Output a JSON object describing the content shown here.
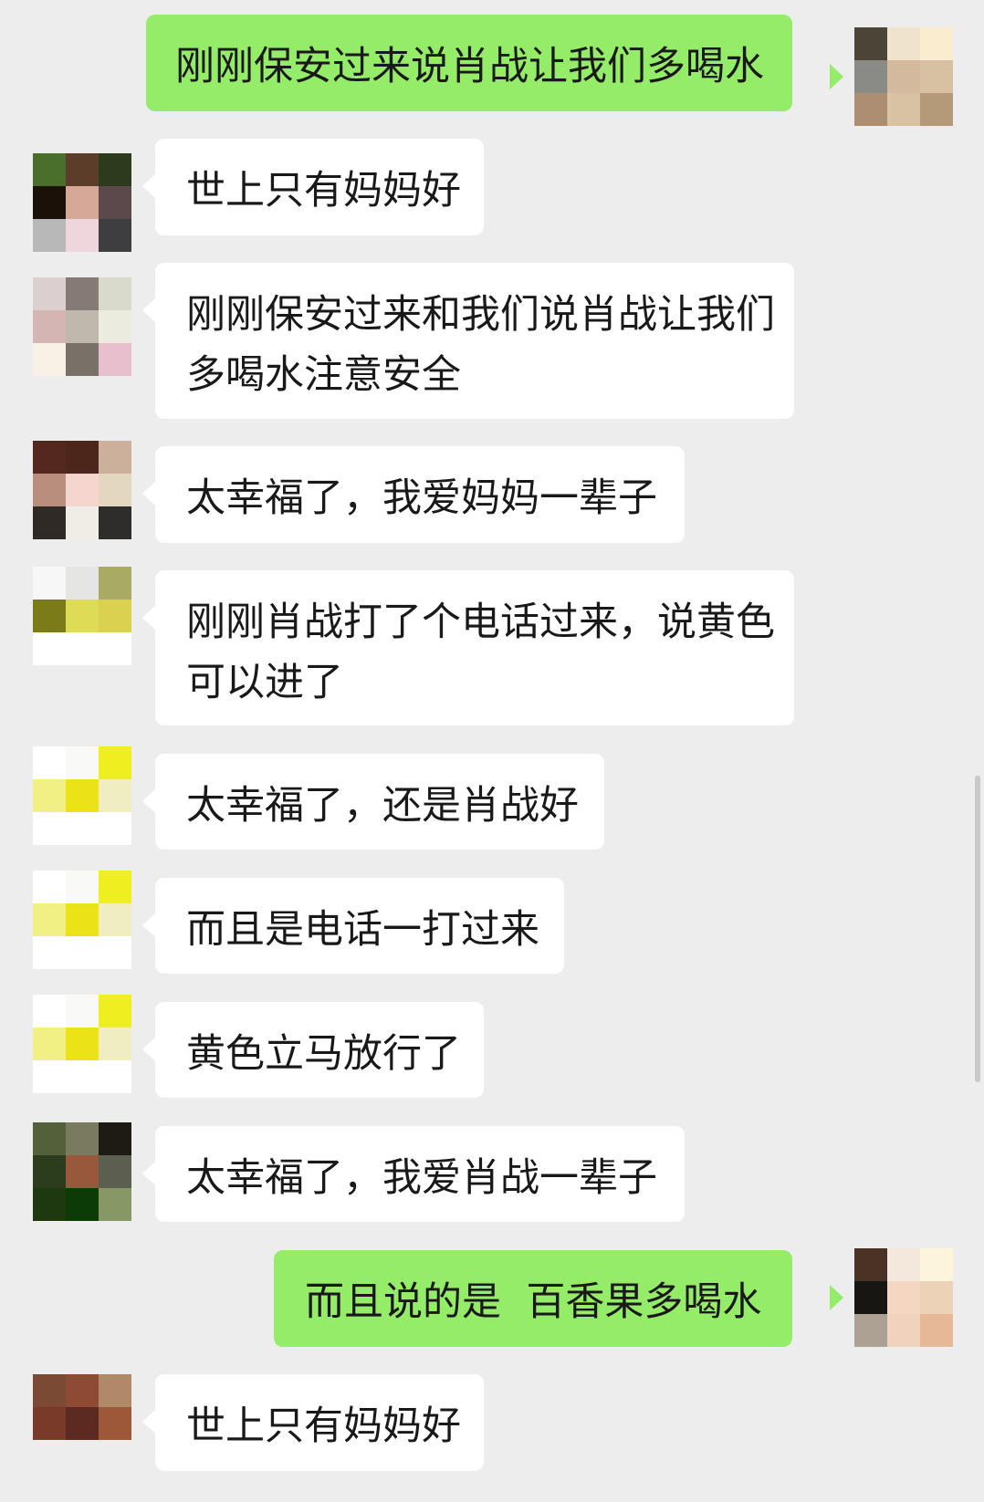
{
  "chat": {
    "messages": [
      {
        "side": "right",
        "text": "刚刚保安过来说肖战让我们多喝水",
        "avatar": [
          "#4b4538",
          "#f0e3cd",
          "#faeccf",
          "#8a8a86",
          "#d3b99e",
          "#d8c1a2",
          "#ad8e73",
          "#d9c2a4",
          "#b49a78"
        ]
      },
      {
        "side": "left",
        "text": "世上只有妈妈好",
        "avatar": [
          "#4a6f2d",
          "#5b3d2a",
          "#2c3a1e",
          "#1c1109",
          "#d6a898",
          "#5c494b",
          "#b8b8b8",
          "#efd5dc",
          "#3e3e40"
        ]
      },
      {
        "side": "left",
        "text": "刚刚保安过来和我们说肖战让我们\n多喝水注意安全",
        "avatar": [
          "#dccfcf",
          "#857a74",
          "#d9d9cc",
          "#d5b5b3",
          "#bfb8ac",
          "#ecebdf",
          "#f9f0e6",
          "#787168",
          "#e8bfcd"
        ]
      },
      {
        "side": "left",
        "text": "太幸福了，我爱妈妈一辈子",
        "avatar": [
          "#52281f",
          "#4c261b",
          "#cdb09b",
          "#b88e7d",
          "#f4d6ce",
          "#e3d7c1",
          "#2f2a26",
          "#f0ece6",
          "#2f2d2c"
        ]
      },
      {
        "side": "left",
        "text": "刚刚肖战打了个电话过来，说黄色\n可以进了",
        "avatar": [
          "#f7f7f7",
          "#e5e5e3",
          "#a9aa63",
          "#7b7b19",
          "#dedb57",
          "#d9d14f",
          "#ffffff",
          "#ffffff",
          "#ffffff"
        ]
      },
      {
        "side": "left",
        "text": "太幸福了，还是肖战好",
        "avatar": [
          "#ffffff",
          "#f9f9f7",
          "#efef20",
          "#f1f084",
          "#ece316",
          "#f0edc0",
          "#ffffff",
          "#ffffff",
          "#ffffff"
        ]
      },
      {
        "side": "left",
        "text": "而且是电话一打过来",
        "avatar": [
          "#ffffff",
          "#f9f9f7",
          "#efef20",
          "#f1f084",
          "#ece316",
          "#f0edc0",
          "#ffffff",
          "#ffffff",
          "#ffffff"
        ]
      },
      {
        "side": "left",
        "text": "黄色立马放行了",
        "avatar": [
          "#ffffff",
          "#f9f9f7",
          "#efef20",
          "#f1f084",
          "#ece316",
          "#f0edc0",
          "#ffffff",
          "#ffffff",
          "#ffffff"
        ]
      },
      {
        "side": "left",
        "text": "太幸福了，我爱肖战一辈子",
        "avatar": [
          "#546039",
          "#7a7a60",
          "#1d1b12",
          "#2c3d1e",
          "#98583b",
          "#5c5f50",
          "#1e3810",
          "#0c3b08",
          "#879866"
        ]
      },
      {
        "side": "right",
        "text": "而且说的是  百香果多喝水",
        "avatar": [
          "#4a3325",
          "#f4e8dc",
          "#fdf4dc",
          "#181612",
          "#f3d7c0",
          "#ecd3b8",
          "#aca192",
          "#efd3bd",
          "#e6b898"
        ]
      },
      {
        "side": "left",
        "text": "世上只有妈妈好",
        "avatar": [
          "#7b4a34",
          "#8e4a32",
          "#b08a68",
          "#7a3a2a",
          "#5c2a1e",
          "#9c5838",
          "#ededed",
          "#ededed",
          "#ededed"
        ]
      }
    ]
  }
}
